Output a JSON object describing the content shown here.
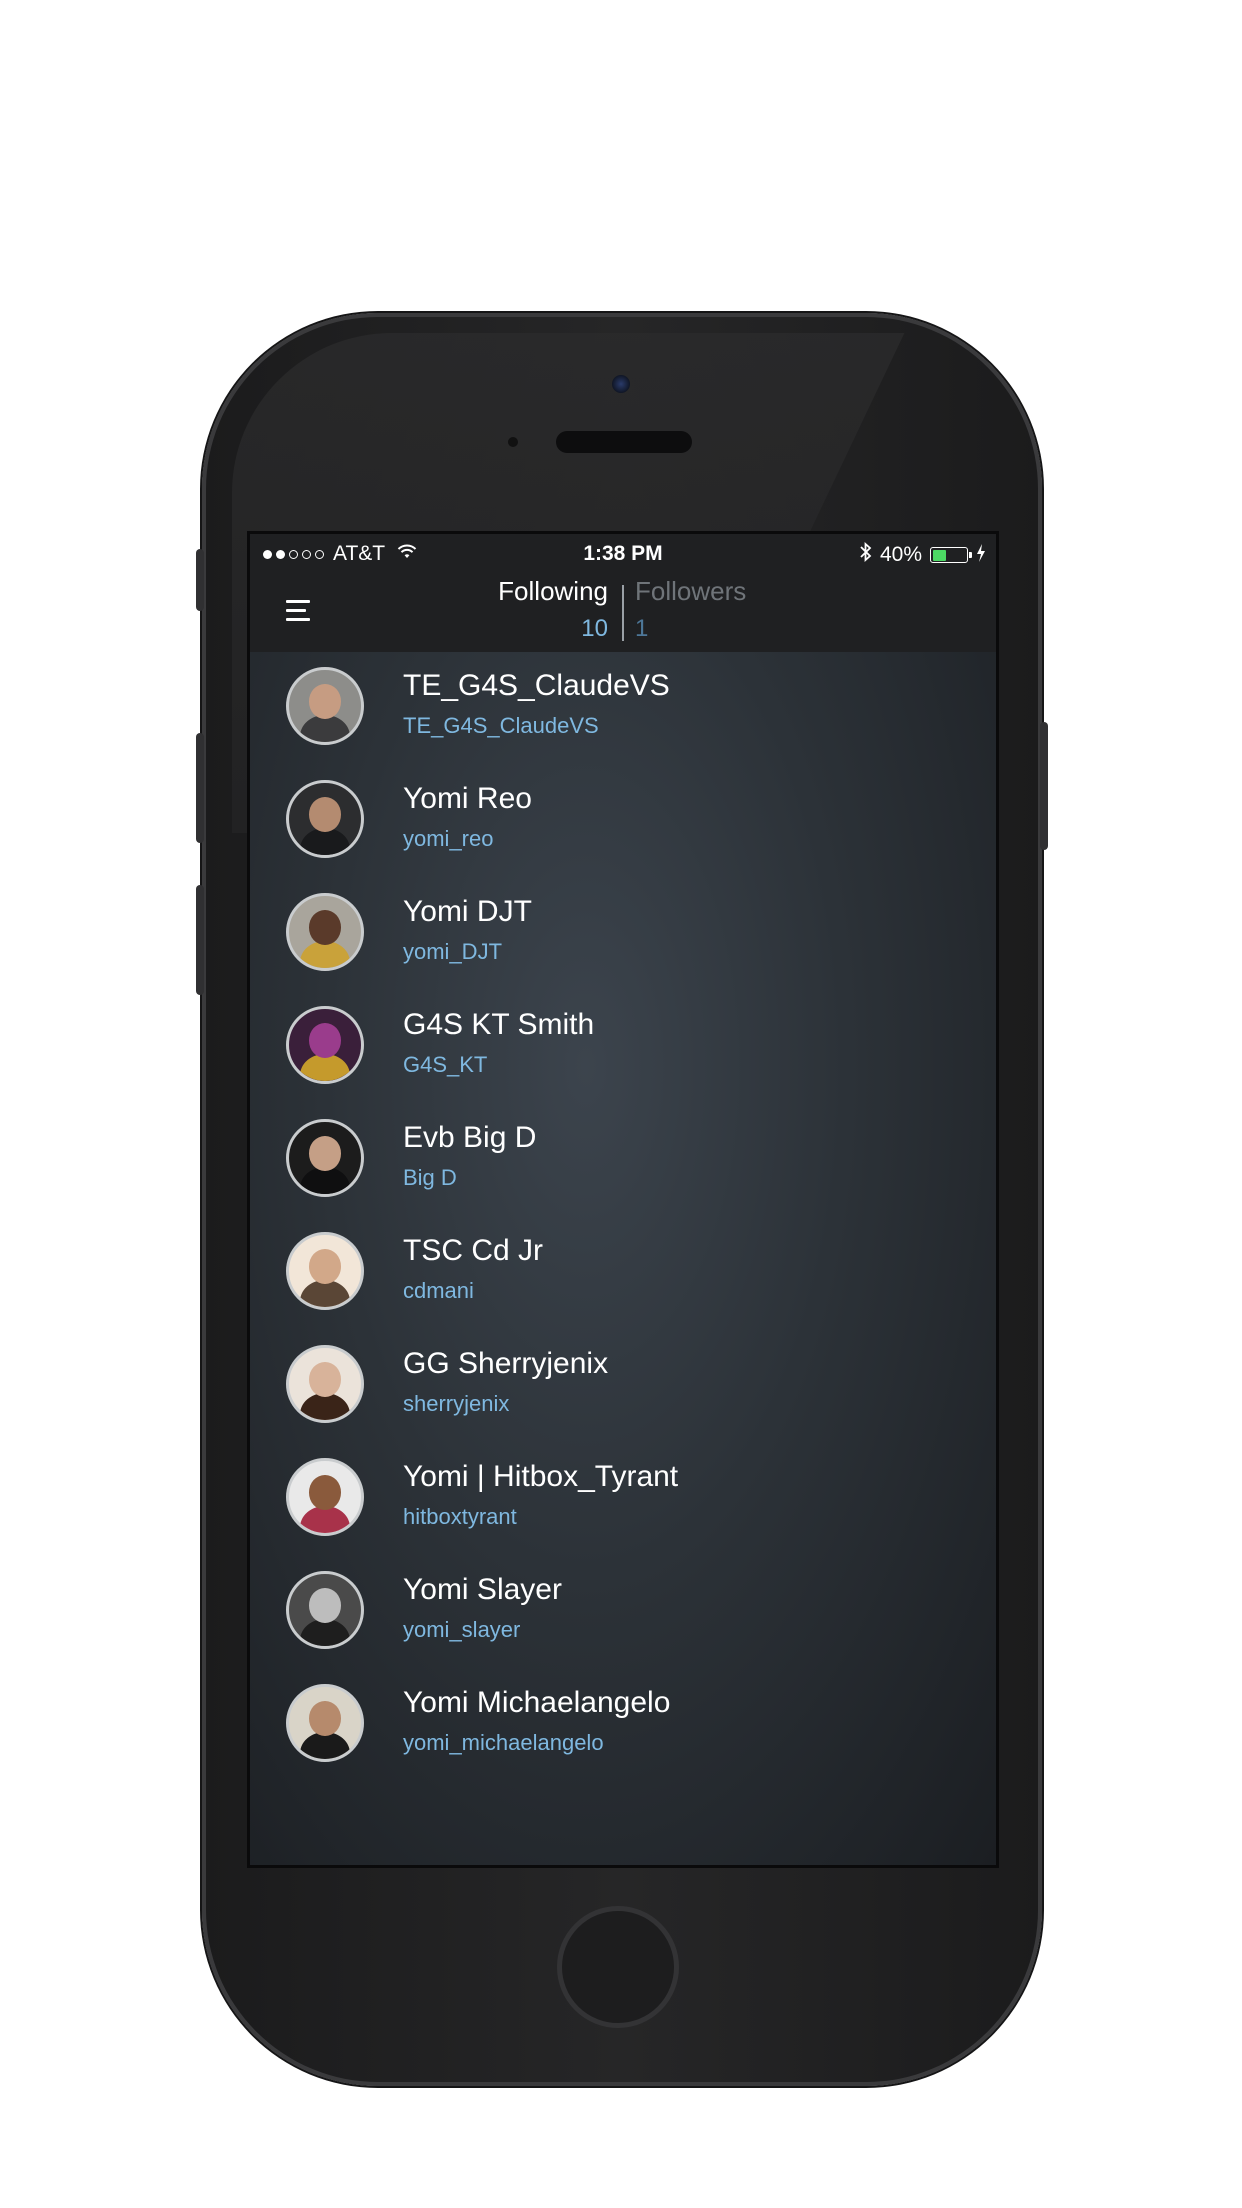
{
  "status_bar": {
    "carrier": "AT&T",
    "signal_bars_filled": 2,
    "signal_bars_total": 5,
    "time": "1:38 PM",
    "battery_percent": "40%",
    "battery_level": 0.4
  },
  "tabs": {
    "following_label": "Following",
    "following_count": "10",
    "followers_label": "Followers",
    "followers_count": "1",
    "active": "following"
  },
  "colors": {
    "accent": "#7fb8e0",
    "top_bar": "#1f2022",
    "battery_fill": "#4cd964"
  },
  "users": [
    {
      "name": "TE_G4S_ClaudeVS",
      "handle": "TE_G4S_ClaudeVS",
      "avatar_bg": "#8d8d8a",
      "avatar_face": "#c69c82",
      "avatar_body": "#3b3b3d"
    },
    {
      "name": "Yomi Reo",
      "handle": "yomi_reo",
      "avatar_bg": "#2c2d2f",
      "avatar_face": "#b48b70",
      "avatar_body": "#191a1c"
    },
    {
      "name": "Yomi DJT",
      "handle": "yomi_DJT",
      "avatar_bg": "#a9a59c",
      "avatar_face": "#5a3a2a",
      "avatar_body": "#c9a23a"
    },
    {
      "name": "G4S KT Smith",
      "handle": "G4S_KT",
      "avatar_bg": "#3a1f3a",
      "avatar_face": "#9a3c8c",
      "avatar_body": "#c59a2c"
    },
    {
      "name": "Evb Big D",
      "handle": "Big D",
      "avatar_bg": "#1c1c1c",
      "avatar_face": "#c59f86",
      "avatar_body": "#0f0f10"
    },
    {
      "name": "TSC Cd Jr",
      "handle": "cdmani",
      "avatar_bg": "#f2e6d8",
      "avatar_face": "#d2a889",
      "avatar_body": "#5a4636"
    },
    {
      "name": "GG Sherryjenix",
      "handle": "sherryjenix",
      "avatar_bg": "#ebe3da",
      "avatar_face": "#d8b39a",
      "avatar_body": "#3a2418"
    },
    {
      "name": "Yomi | Hitbox_Tyrant",
      "handle": "hitboxtyrant",
      "avatar_bg": "#e9e9e9",
      "avatar_face": "#8a5a3c",
      "avatar_body": "#a8324a"
    },
    {
      "name": "Yomi Slayer",
      "handle": "yomi_slayer",
      "avatar_bg": "#4a4a4a",
      "avatar_face": "#bdbdbd",
      "avatar_body": "#1e1e1e"
    },
    {
      "name": "Yomi Michaelangelo",
      "handle": "yomi_michaelangelo",
      "avatar_bg": "#d9d4c8",
      "avatar_face": "#b68a6c",
      "avatar_body": "#1a1a1a"
    }
  ]
}
